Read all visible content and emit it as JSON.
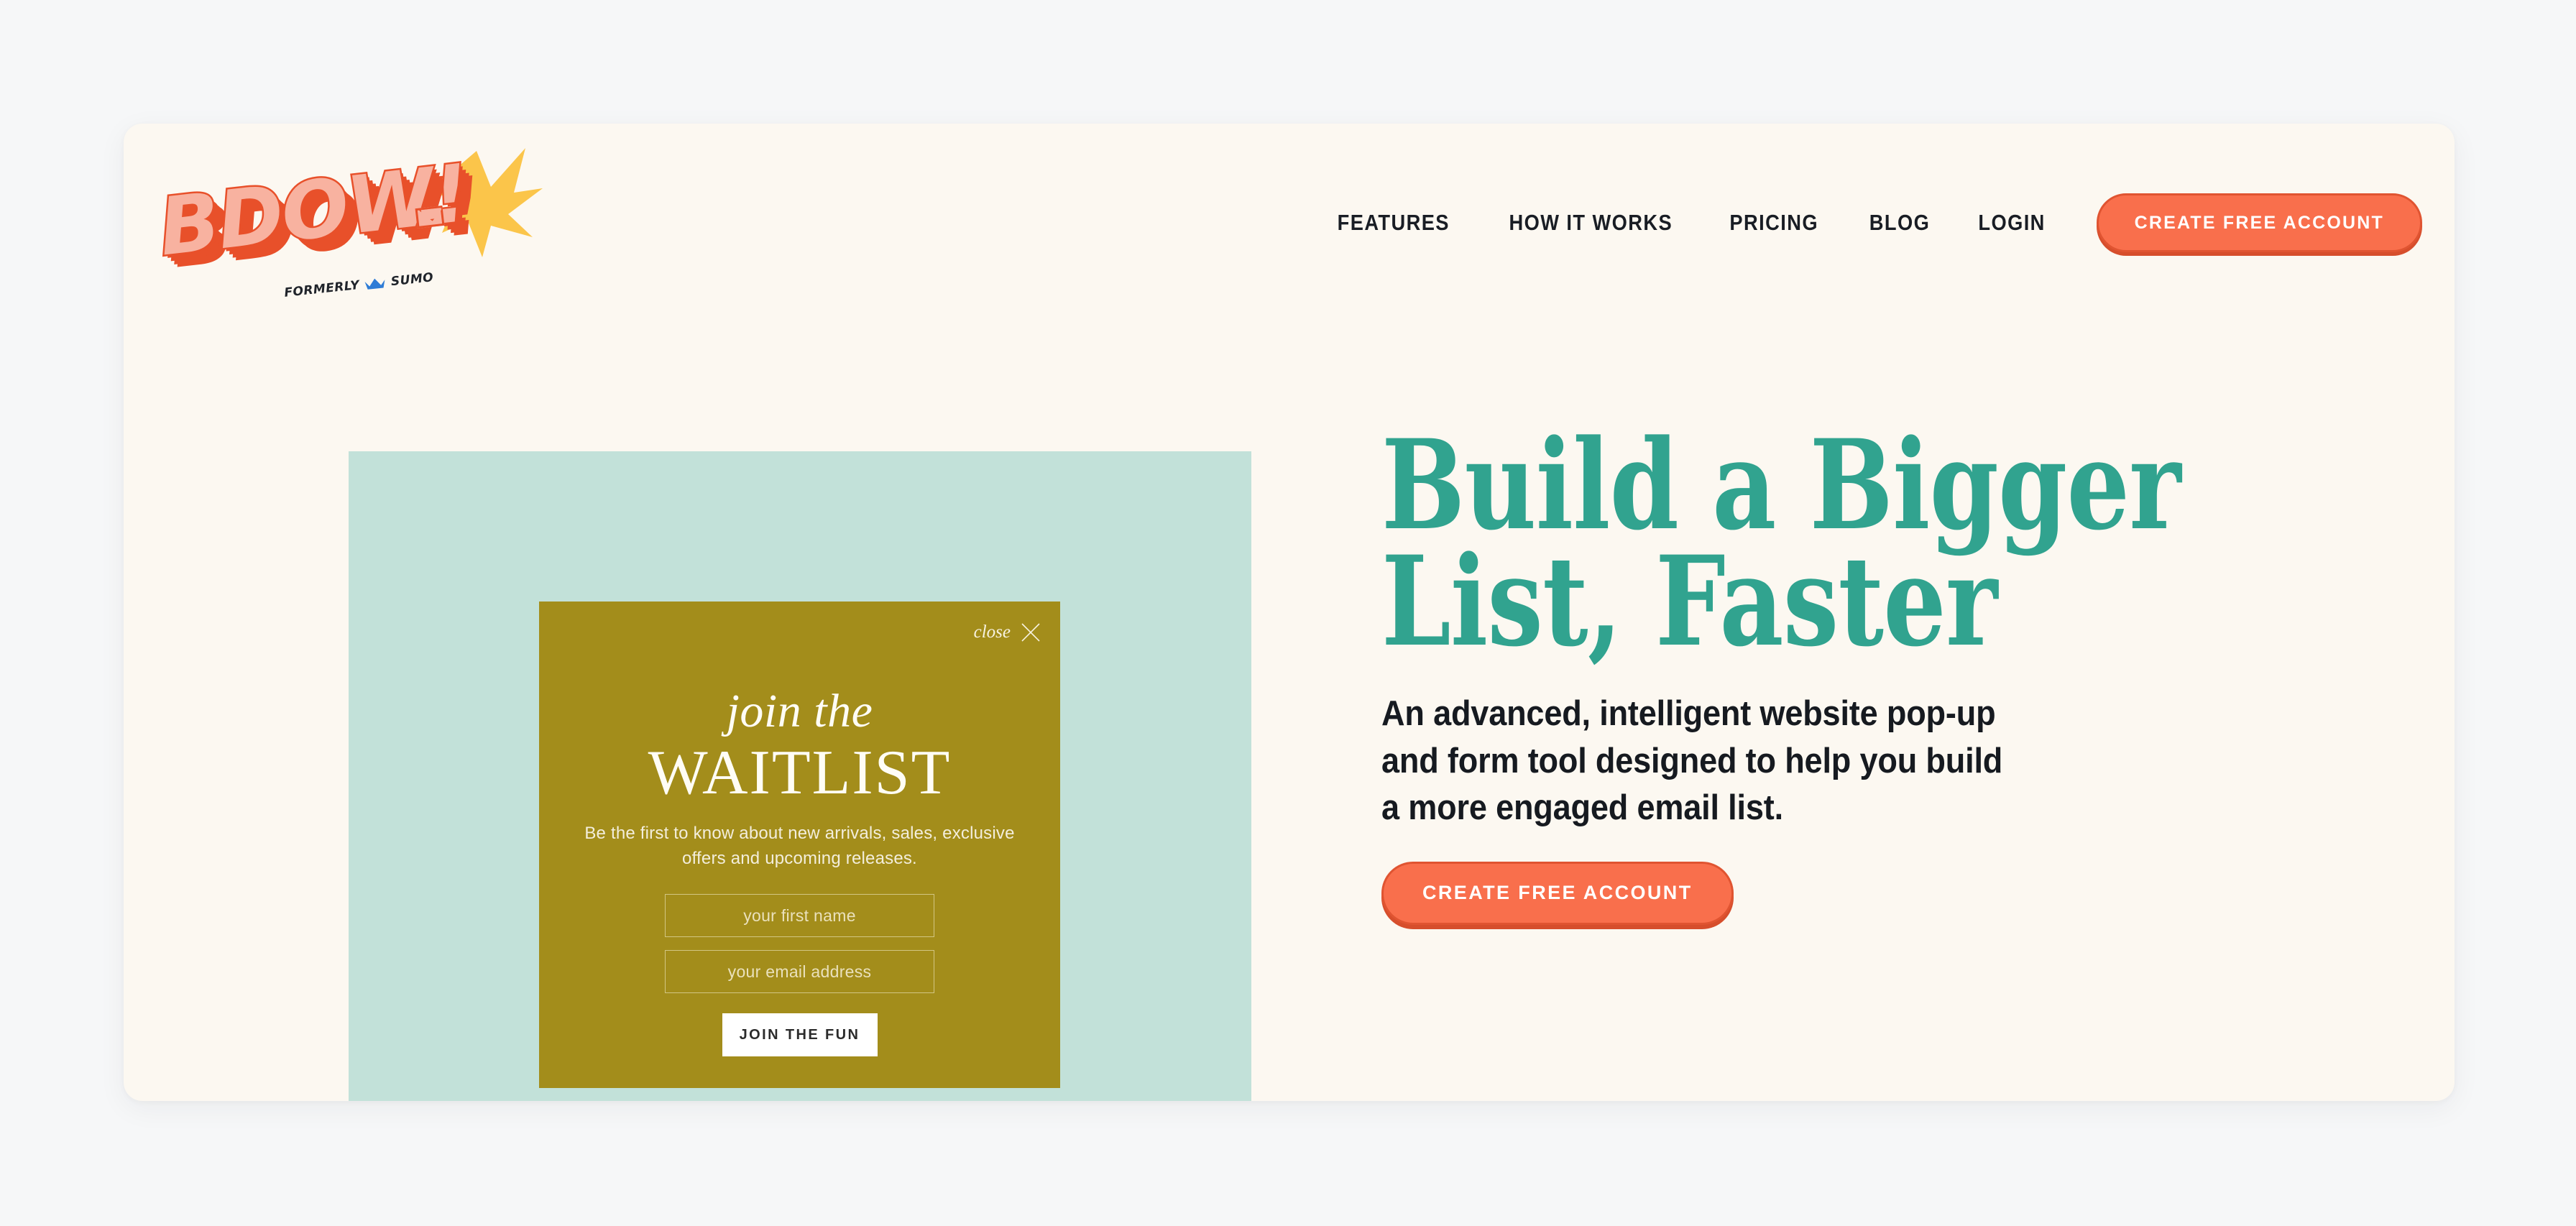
{
  "theme": {
    "page_background": "#F6F7F8",
    "card_background": "#FCF8F1",
    "accent_orange": "#F96F4C",
    "accent_orange_dark": "#E05431",
    "accent_teal": "#31A38F",
    "mint_panel": "#C2E1D9",
    "olive_popup": "#A38D1B",
    "logo_orange": "#E8502A",
    "logo_salmon": "#F8B2A0",
    "logo_star_yellow": "#FBC54A",
    "sumo_crown_blue": "#2E7CD6"
  },
  "header": {
    "logo": {
      "wordmark": "BDOW!",
      "tagline_prefix": "FORMERLY",
      "tagline_brand": "SUMO",
      "crown_icon": "crown-icon",
      "envelope_icon": "envelope-icon",
      "star_icon": "starburst-icon"
    },
    "nav_items": [
      {
        "label": "FEATURES",
        "name": "nav-link-features"
      },
      {
        "label": "HOW IT WORKS",
        "name": "nav-link-how-it-works"
      },
      {
        "label": "PRICING",
        "name": "nav-link-pricing"
      },
      {
        "label": "BLOG",
        "name": "nav-link-blog"
      },
      {
        "label": "LOGIN",
        "name": "nav-link-login"
      }
    ],
    "cta_label": "CREATE FREE ACCOUNT"
  },
  "hero": {
    "headline_line1": "Build a Bigger",
    "headline_line2": "List, Faster",
    "subheadline": "An advanced, intelligent website pop-up and form tool designed to help you build a more engaged email list.",
    "cta_label": "CREATE FREE ACCOUNT"
  },
  "popup_mock": {
    "close_label": "close",
    "close_icon": "close-x-icon",
    "eyebrow": "join the",
    "title": "WAITLIST",
    "description": "Be the first to know about new arrivals, sales, exclusive offers and upcoming releases.",
    "fields": [
      {
        "placeholder": "your first name",
        "value": "",
        "name": "popup-first-name-input"
      },
      {
        "placeholder": "your email address",
        "value": "",
        "name": "popup-email-input"
      }
    ],
    "submit_label": "JOIN THE FUN"
  }
}
